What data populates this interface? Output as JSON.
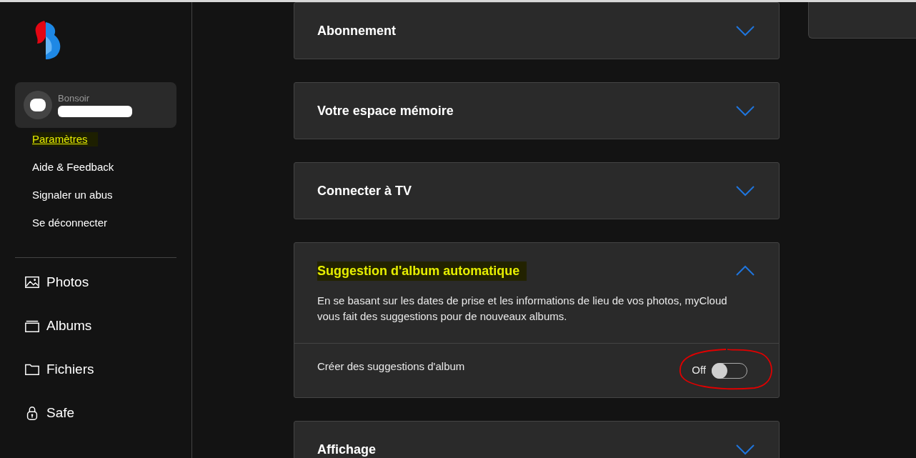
{
  "user_card": {
    "greeting": "Bonsoir",
    "name_redacted": true
  },
  "account_menu": [
    {
      "label": "Paramètres",
      "selected": true,
      "highlighted": true
    },
    {
      "label": "Aide & Feedback",
      "selected": false,
      "highlighted": false
    },
    {
      "label": "Signaler un abus",
      "selected": false,
      "highlighted": false
    },
    {
      "label": "Se déconnecter",
      "selected": false,
      "highlighted": false
    }
  ],
  "nav": [
    {
      "label": "Photos",
      "kind": "photos"
    },
    {
      "label": "Albums",
      "kind": "albums"
    },
    {
      "label": "Fichiers",
      "kind": "files"
    },
    {
      "label": "Safe",
      "kind": "safe"
    }
  ],
  "sections": [
    {
      "title": "Abonnement",
      "expanded": false,
      "highlighted": false
    },
    {
      "title": "Votre espace mémoire",
      "expanded": false,
      "highlighted": false
    },
    {
      "title": "Connecter à TV",
      "expanded": false,
      "highlighted": false
    },
    {
      "title": "Suggestion d'album automatique",
      "expanded": true,
      "highlighted": true,
      "description": "En se basant sur les dates de prise et les informations de lieu de vos photos, myCloud vous fait des suggestions pour de nouveaux albums.",
      "setting": {
        "label": "Créer des suggestions d'album",
        "state_label": "Off",
        "on": false,
        "circled": true
      }
    },
    {
      "title": "Affichage",
      "expanded": false,
      "highlighted": false
    }
  ]
}
